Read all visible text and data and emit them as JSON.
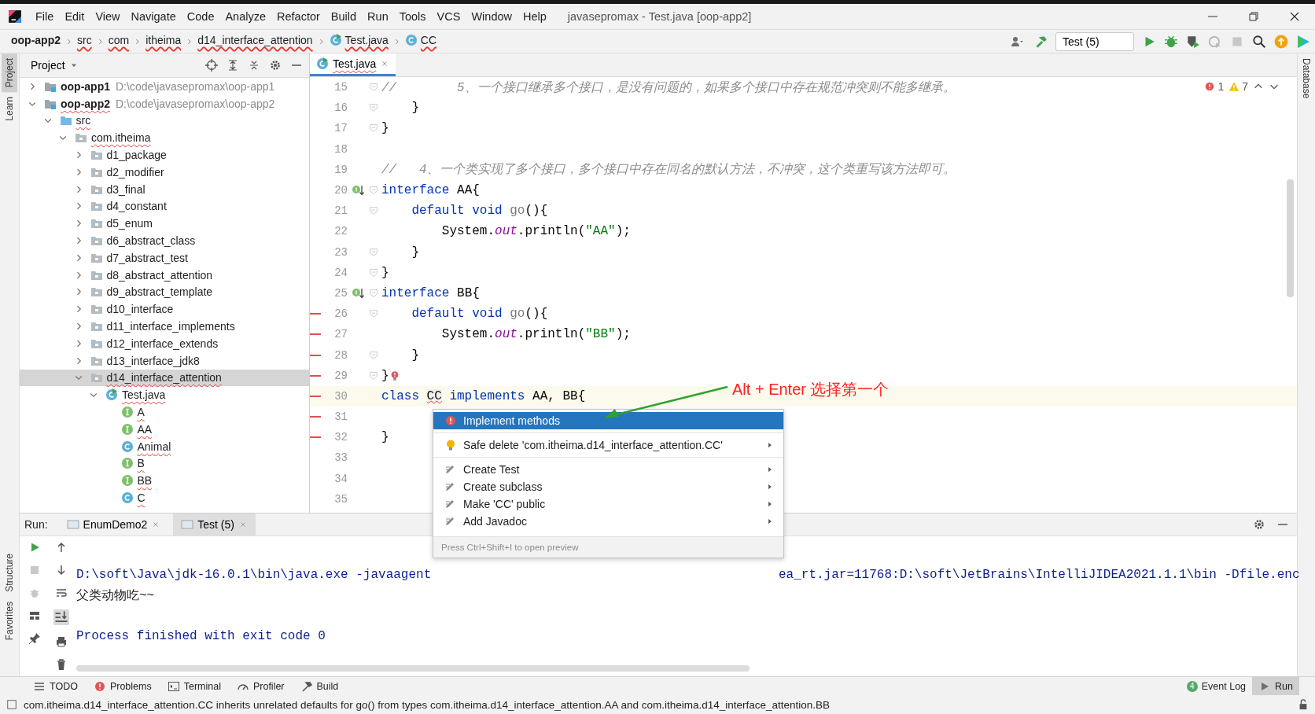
{
  "window": {
    "title": "javasepromax - Test.java [oop-app2]"
  },
  "menu": [
    "File",
    "Edit",
    "View",
    "Navigate",
    "Code",
    "Analyze",
    "Refactor",
    "Build",
    "Run",
    "Tools",
    "VCS",
    "Window",
    "Help"
  ],
  "breadcrumbs": [
    {
      "label": "oop-app2",
      "kind": "module",
      "error": false
    },
    {
      "label": "src",
      "kind": "folder",
      "error": true
    },
    {
      "label": "com",
      "kind": "folder",
      "error": true
    },
    {
      "label": "itheima",
      "kind": "folder",
      "error": true
    },
    {
      "label": "d14_interface_attention",
      "kind": "folder",
      "error": true
    },
    {
      "label": "Test.java",
      "kind": "class_file",
      "error": true
    },
    {
      "label": "CC",
      "kind": "class",
      "error": true
    }
  ],
  "toolbar": {
    "run_config": "Test (5)"
  },
  "tool_strips": {
    "left_top": [
      {
        "label": "Project",
        "selected": true
      },
      {
        "label": "Learn",
        "selected": false
      }
    ],
    "left_bottom": [
      {
        "label": "Structure",
        "selected": false
      },
      {
        "label": "Favorites",
        "selected": false
      }
    ],
    "right": [
      {
        "label": "Database",
        "selected": false
      }
    ]
  },
  "project": {
    "title": "Project",
    "tree": [
      {
        "label": "oop-app1",
        "kind": "module",
        "path": "D:\\code\\javasepromax\\oop-app1",
        "expanded": false,
        "selected": false,
        "error": false
      },
      {
        "label": "oop-app2",
        "kind": "module",
        "path": "D:\\code\\javasepromax\\oop-app2",
        "expanded": true,
        "selected": false,
        "error": true,
        "children": [
          {
            "label": "src",
            "kind": "source",
            "expanded": true,
            "selected": false,
            "error": true,
            "children": [
              {
                "label": "com.itheima",
                "kind": "package",
                "expanded": true,
                "selected": false,
                "error": true,
                "children": [
                  {
                    "label": "d1_package",
                    "kind": "package",
                    "expanded": false,
                    "selected": false,
                    "error": false
                  },
                  {
                    "label": "d2_modifier",
                    "kind": "package",
                    "expanded": false,
                    "selected": false,
                    "error": false
                  },
                  {
                    "label": "d3_final",
                    "kind": "package",
                    "expanded": false,
                    "selected": false,
                    "error": false
                  },
                  {
                    "label": "d4_constant",
                    "kind": "package",
                    "expanded": false,
                    "selected": false,
                    "error": false
                  },
                  {
                    "label": "d5_enum",
                    "kind": "package",
                    "expanded": false,
                    "selected": false,
                    "error": false
                  },
                  {
                    "label": "d6_abstract_class",
                    "kind": "package",
                    "expanded": false,
                    "selected": false,
                    "error": false
                  },
                  {
                    "label": "d7_abstract_test",
                    "kind": "package",
                    "expanded": false,
                    "selected": false,
                    "error": false
                  },
                  {
                    "label": "d8_abstract_attention",
                    "kind": "package",
                    "expanded": false,
                    "selected": false,
                    "error": false
                  },
                  {
                    "label": "d9_abstract_template",
                    "kind": "package",
                    "expanded": false,
                    "selected": false,
                    "error": false
                  },
                  {
                    "label": "d10_interface",
                    "kind": "package",
                    "expanded": false,
                    "selected": false,
                    "error": false
                  },
                  {
                    "label": "d11_interface_implements",
                    "kind": "package",
                    "expanded": false,
                    "selected": false,
                    "error": false
                  },
                  {
                    "label": "d12_interface_extends",
                    "kind": "package",
                    "expanded": false,
                    "selected": false,
                    "error": false
                  },
                  {
                    "label": "d13_interface_jdk8",
                    "kind": "package",
                    "expanded": false,
                    "selected": false,
                    "error": false
                  },
                  {
                    "label": "d14_interface_attention",
                    "kind": "package",
                    "expanded": true,
                    "selected": true,
                    "error": true,
                    "children": [
                      {
                        "label": "Test.java",
                        "kind": "class_file",
                        "expanded": true,
                        "selected": false,
                        "error": true,
                        "children": [
                          {
                            "label": "A",
                            "kind": "interface",
                            "selected": false,
                            "error": true
                          },
                          {
                            "label": "AA",
                            "kind": "interface",
                            "selected": false,
                            "error": true
                          },
                          {
                            "label": "Animal",
                            "kind": "class",
                            "selected": false,
                            "error": true
                          },
                          {
                            "label": "B",
                            "kind": "interface",
                            "selected": false,
                            "error": true
                          },
                          {
                            "label": "BB",
                            "kind": "interface",
                            "selected": false,
                            "error": true
                          },
                          {
                            "label": "C",
                            "kind": "class",
                            "selected": false,
                            "error": true
                          }
                        ]
                      }
                    ]
                  }
                ]
              }
            ]
          }
        ]
      }
    ]
  },
  "editor": {
    "tabs": [
      {
        "label": "Test.java",
        "selected": true
      }
    ],
    "errors": "1",
    "warnings": "7",
    "lines": [
      {
        "number": "15",
        "fold": true,
        "changed": false,
        "current": false,
        "error_bulb": false,
        "segments": [
          {
            "kind": "comment",
            "text": "//        5、一个接口继承多个接口，是没有问题的，如果多个接口中存在规范冲突则不能多继承。"
          }
        ]
      },
      {
        "number": "16",
        "fold": true,
        "changed": false,
        "current": false,
        "error_bulb": false,
        "segments": [
          {
            "kind": "plain",
            "text": "    }"
          }
        ]
      },
      {
        "number": "17",
        "fold": true,
        "changed": false,
        "current": false,
        "error_bulb": false,
        "segments": [
          {
            "kind": "plain",
            "text": "}"
          }
        ]
      },
      {
        "number": "18",
        "fold": false,
        "changed": false,
        "current": false,
        "error_bulb": false
      },
      {
        "number": "19",
        "fold": false,
        "changed": false,
        "current": false,
        "error_bulb": false,
        "segments": [
          {
            "kind": "comment",
            "text": "//   4、一个类实现了多个接口，多个接口中存在同名的默认方法，不冲突，这个类重写该方法即可。"
          }
        ]
      },
      {
        "number": "20",
        "fold": true,
        "changed": false,
        "current": false,
        "error_bulb": false,
        "implemented": true,
        "segments": [
          {
            "kind": "keyword",
            "text": "interface"
          },
          {
            "kind": "plain",
            "text": " AA{"
          }
        ]
      },
      {
        "number": "21",
        "fold": true,
        "changed": false,
        "current": false,
        "error_bulb": false,
        "segments": [
          {
            "kind": "keyword",
            "text": "    default void"
          },
          {
            "kind": "unused",
            "text": " go"
          },
          {
            "kind": "plain",
            "text": "(){"
          }
        ]
      },
      {
        "number": "22",
        "fold": false,
        "changed": false,
        "current": false,
        "error_bulb": false,
        "segments": [
          {
            "kind": "plain",
            "text": "        System."
          },
          {
            "kind": "field",
            "text": "out"
          },
          {
            "kind": "plain",
            "text": ".println("
          },
          {
            "kind": "string",
            "text": "\"AA\""
          },
          {
            "kind": "plain",
            "text": ");"
          }
        ]
      },
      {
        "number": "23",
        "fold": true,
        "changed": false,
        "current": false,
        "error_bulb": false,
        "segments": [
          {
            "kind": "plain",
            "text": "    }"
          }
        ]
      },
      {
        "number": "24",
        "fold": true,
        "changed": false,
        "current": false,
        "error_bulb": false,
        "segments": [
          {
            "kind": "plain",
            "text": "}"
          }
        ]
      },
      {
        "number": "25",
        "fold": true,
        "changed": false,
        "current": false,
        "error_bulb": false,
        "implemented": true,
        "segments": [
          {
            "kind": "keyword",
            "text": "interface"
          },
          {
            "kind": "plain",
            "text": " BB{"
          }
        ]
      },
      {
        "number": "26",
        "fold": true,
        "changed": true,
        "current": false,
        "error_bulb": false,
        "segments": [
          {
            "kind": "keyword",
            "text": "    default void"
          },
          {
            "kind": "unused",
            "text": " go"
          },
          {
            "kind": "plain",
            "text": "(){"
          }
        ]
      },
      {
        "number": "27",
        "fold": false,
        "changed": true,
        "current": false,
        "error_bulb": false,
        "segments": [
          {
            "kind": "plain",
            "text": "        System."
          },
          {
            "kind": "field",
            "text": "out"
          },
          {
            "kind": "plain",
            "text": ".println("
          },
          {
            "kind": "string",
            "text": "\"BB\""
          },
          {
            "kind": "plain",
            "text": ");"
          }
        ]
      },
      {
        "number": "28",
        "fold": true,
        "changed": true,
        "current": false,
        "error_bulb": false,
        "segments": [
          {
            "kind": "plain",
            "text": "    }"
          }
        ]
      },
      {
        "number": "29",
        "fold": true,
        "changed": true,
        "current": false,
        "error_bulb": true,
        "segments": [
          {
            "kind": "plain",
            "text": "}"
          }
        ]
      },
      {
        "number": "30",
        "fold": false,
        "changed": true,
        "current": true,
        "error_bulb": false,
        "segments": [
          {
            "kind": "keyword",
            "text": "class "
          },
          {
            "kind": "error",
            "text": "CC"
          },
          {
            "kind": "keyword",
            "text": " implements"
          },
          {
            "kind": "plain",
            "text": " AA, BB{"
          }
        ]
      },
      {
        "number": "31",
        "fold": false,
        "changed": true,
        "current": false,
        "error_bulb": false
      },
      {
        "number": "32",
        "fold": false,
        "changed": true,
        "current": false,
        "error_bulb": false,
        "segments": [
          {
            "kind": "plain",
            "text": "}"
          }
        ]
      },
      {
        "number": "33",
        "fold": false,
        "changed": false,
        "current": false,
        "error_bulb": false
      },
      {
        "number": "34",
        "fold": false,
        "changed": false,
        "current": false,
        "error_bulb": false
      },
      {
        "number": "35",
        "fold": false,
        "changed": false,
        "current": false,
        "error_bulb": false
      }
    ]
  },
  "popup": {
    "items": [
      {
        "kind": "error_fix",
        "label": "Implement methods",
        "selected": true,
        "submenu": false,
        "separator_before": false
      },
      {
        "kind": "bulb",
        "label": "Safe delete 'com.itheima.d14_interface_attention.CC'",
        "selected": false,
        "submenu": true,
        "separator_before": true
      },
      {
        "kind": "intention",
        "label": "Create Test",
        "selected": false,
        "submenu": true,
        "separator_before": true
      },
      {
        "kind": "intention",
        "label": "Create subclass",
        "selected": false,
        "submenu": true,
        "separator_before": false
      },
      {
        "kind": "intention",
        "label": "Make 'CC' public",
        "selected": false,
        "submenu": true,
        "separator_before": false
      },
      {
        "kind": "intention",
        "label": "Add Javadoc",
        "selected": false,
        "submenu": true,
        "separator_before": false
      }
    ],
    "hint": "Press Ctrl+Shift+I to open preview"
  },
  "annotation": {
    "text": "Alt + Enter 选择第一个"
  },
  "run": {
    "label": "Run:",
    "tabs": [
      {
        "label": "EnumDemo2",
        "selected": false
      },
      {
        "label": "Test (5)",
        "selected": true
      }
    ],
    "output": [
      {
        "kind": "command",
        "segments": [
          "D:\\soft\\Java\\jdk-16.0.1\\bin\\java.exe -javaagent",
          "ea_rt.jar=11768:D:\\soft\\JetBrains\\IntelliJIDEA2021.1.1\\bin -Dfile.enc"
        ]
      },
      {
        "kind": "stdout",
        "segments": [
          "父类动物吃~~"
        ]
      },
      {
        "kind": "exit",
        "segments": [
          "Process finished with exit code 0"
        ]
      }
    ]
  },
  "bottom_bar": {
    "left": [
      {
        "label": "TODO",
        "kind": "todo"
      },
      {
        "label": "Problems",
        "kind": "problems"
      },
      {
        "label": "Terminal",
        "kind": "terminal"
      },
      {
        "label": "Profiler",
        "kind": "profiler"
      },
      {
        "label": "Build",
        "kind": "build"
      }
    ],
    "right": [
      {
        "label": "Event Log",
        "kind": "event_log",
        "badge": "4",
        "selected": false
      },
      {
        "label": "Run",
        "kind": "run",
        "selected": true
      }
    ]
  },
  "status": "com.itheima.d14_interface_attention.CC inherits unrelated defaults for go() from types com.itheima.d14_interface_attention.AA and com.itheima.d14_interface_attention.BB"
}
